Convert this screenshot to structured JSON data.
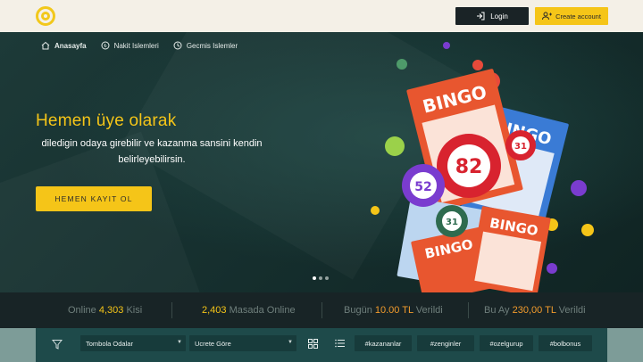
{
  "header": {
    "login_label": "Login",
    "create_label": "Create account"
  },
  "nav": {
    "items": [
      {
        "label": "Anasayfa",
        "icon": "home-icon"
      },
      {
        "label": "Nakit Islemleri",
        "icon": "coin-icon"
      },
      {
        "label": "Gecmis Islemler",
        "icon": "clock-icon"
      }
    ]
  },
  "hero": {
    "title": "Hemen üye olarak",
    "subtitle": "diledigin odaya girebilir ve kazanma sansini kendin belirleyebilirsin.",
    "cta": "HEMEN KAYIT OL",
    "card_word": "BINGO",
    "balls": [
      "82",
      "52",
      "31",
      "31"
    ]
  },
  "stats": {
    "online_label": "Online",
    "online_count": "4,303",
    "online_unit": "Kisi",
    "tables_count": "2,403",
    "tables_label": "Masada Online",
    "today_label": "Bugün",
    "today_value": "10.00",
    "today_currency": "TL",
    "today_suffix": "Verildi",
    "month_label": "Bu Ay",
    "month_value": "230,00",
    "month_currency": "TL",
    "month_suffix": "Verildi"
  },
  "filters": {
    "room_select": "Tombola Odalar",
    "price_select": "Ucrete Göre",
    "tags": [
      "#kazananlar",
      "#zenginler",
      "#ozelgurup",
      "#bolbonus"
    ]
  },
  "colors": {
    "accent": "#f5c518",
    "dark": "#1a2326",
    "bingo_orange": "#e8562f",
    "bingo_blue": "#3a7bd5",
    "ball_red": "#d8232f"
  }
}
